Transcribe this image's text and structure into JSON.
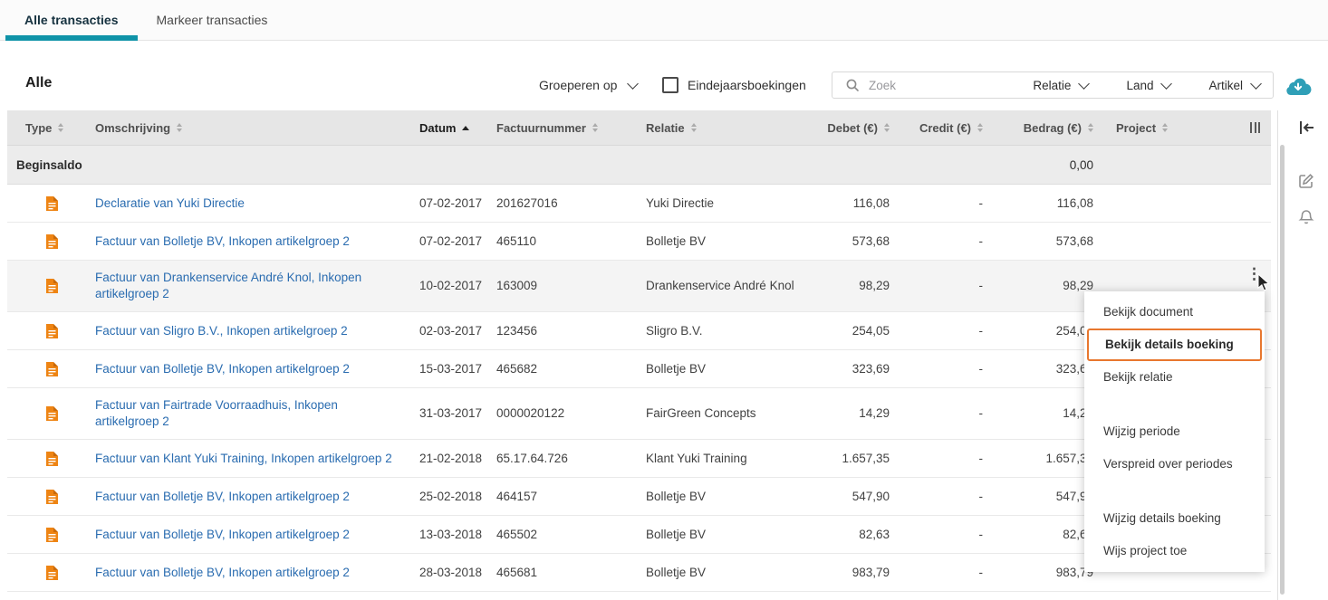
{
  "tabs": [
    {
      "label": "Alle transacties",
      "active": true
    },
    {
      "label": "Markeer transacties",
      "active": false
    }
  ],
  "toolbar": {
    "title": "Alle",
    "group_by": "Groeperen op",
    "year_end_label": "Eindejaarsboekingen",
    "year_end_checked": false,
    "search_placeholder": "Zoek",
    "filters": [
      "Relatie",
      "Land",
      "Artikel"
    ]
  },
  "table": {
    "columns": [
      {
        "label": "Type"
      },
      {
        "label": "Omschrijving"
      },
      {
        "label": "Datum",
        "sorted": "asc"
      },
      {
        "label": "Factuurnummer"
      },
      {
        "label": "Relatie"
      },
      {
        "label": "Debet (€)",
        "align": "right"
      },
      {
        "label": "Credit (€)",
        "align": "right"
      },
      {
        "label": "Bedrag (€)",
        "align": "right"
      },
      {
        "label": "Project"
      }
    ],
    "opening_balance": {
      "label": "Beginsaldo",
      "amount": "0,00"
    },
    "rows": [
      {
        "description": "Declaratie van Yuki Directie",
        "date": "07-02-2017",
        "invoice_number": "201627016",
        "relation": "Yuki Directie",
        "debit": "116,08",
        "credit": "-",
        "amount": "116,08"
      },
      {
        "description": "Factuur van Bolletje BV, Inkopen artikelgroep 2",
        "date": "07-02-2017",
        "invoice_number": "465110",
        "relation": "Bolletje BV",
        "debit": "573,68",
        "credit": "-",
        "amount": "573,68"
      },
      {
        "description": "Factuur van Drankenservice André Knol, Inkopen artikelgroep 2",
        "date": "10-02-2017",
        "invoice_number": "163009",
        "relation": "Drankenservice André Knol",
        "debit": "98,29",
        "credit": "-",
        "amount": "98,29",
        "highlighted": true,
        "menu_open": true
      },
      {
        "description": "Factuur van Sligro B.V., Inkopen artikelgroep 2",
        "date": "02-03-2017",
        "invoice_number": "123456",
        "relation": "Sligro B.V.",
        "debit": "254,05",
        "credit": "-",
        "amount": "254,05"
      },
      {
        "description": "Factuur van Bolletje BV, Inkopen artikelgroep 2",
        "date": "15-03-2017",
        "invoice_number": "465682",
        "relation": "Bolletje BV",
        "debit": "323,69",
        "credit": "-",
        "amount": "323,69"
      },
      {
        "description": "Factuur van Fairtrade Voorraadhuis, Inkopen artikelgroep 2",
        "date": "31-03-2017",
        "invoice_number": "0000020122",
        "relation": "FairGreen Concepts",
        "debit": "14,29",
        "credit": "-",
        "amount": "14,29"
      },
      {
        "description": "Factuur van Klant Yuki Training, Inkopen artikelgroep 2",
        "date": "21-02-2018",
        "invoice_number": "65.17.64.726",
        "relation": "Klant Yuki Training",
        "debit": "1.657,35",
        "credit": "-",
        "amount": "1.657,35"
      },
      {
        "description": "Factuur van Bolletje BV, Inkopen artikelgroep 2",
        "date": "25-02-2018",
        "invoice_number": "464157",
        "relation": "Bolletje BV",
        "debit": "547,90",
        "credit": "-",
        "amount": "547,90"
      },
      {
        "description": "Factuur van Bolletje BV, Inkopen artikelgroep 2",
        "date": "13-03-2018",
        "invoice_number": "465502",
        "relation": "Bolletje BV",
        "debit": "82,63",
        "credit": "-",
        "amount": "82,63"
      },
      {
        "description": "Factuur van Bolletje BV, Inkopen artikelgroep 2",
        "date": "28-03-2018",
        "invoice_number": "465681",
        "relation": "Bolletje BV",
        "debit": "983,79",
        "credit": "-",
        "amount": "983,79"
      }
    ]
  },
  "context_menu": {
    "groups": [
      [
        {
          "label": "Bekijk document"
        },
        {
          "label": "Bekijk details boeking",
          "highlighted": true
        },
        {
          "label": "Bekijk relatie"
        }
      ],
      [
        {
          "label": "Wijzig periode"
        },
        {
          "label": "Verspreid over periodes"
        }
      ],
      [
        {
          "label": "Wijzig details boeking"
        },
        {
          "label": "Wijs project toe"
        }
      ]
    ],
    "highlight_color": "#e8772e"
  },
  "colors": {
    "accent_teal": "#0f93a8",
    "orange": "#e8772e",
    "link_blue": "#2a6cb0"
  }
}
